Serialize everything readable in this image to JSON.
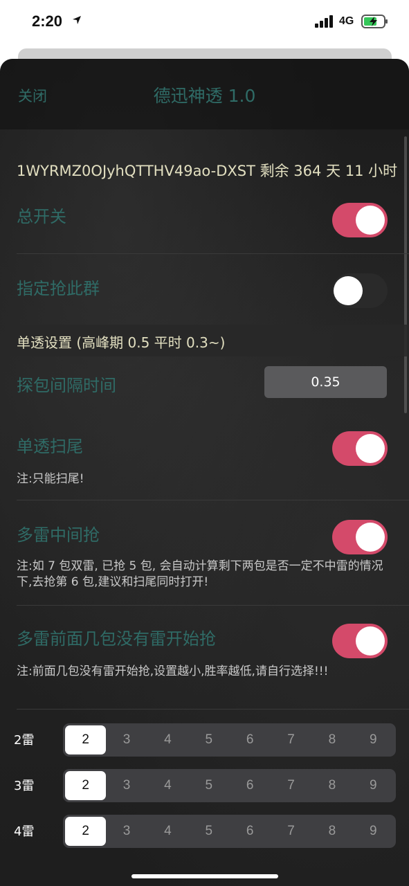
{
  "status": {
    "time": "2:20",
    "network": "4G"
  },
  "nav": {
    "close_label": "关闭",
    "title": "德迅神透 1.0"
  },
  "license_text": "1WYRMZ0OJyhQTTHV49ao-DXST 剩余 364 天 11 小时",
  "rows": {
    "master_switch": {
      "label": "总开关",
      "on": true
    },
    "target_group": {
      "label": "指定抢此群",
      "on": false
    }
  },
  "section": {
    "single_settings": "单透设置 (高峰期 0.5 平时 0.3~)"
  },
  "interval": {
    "label": "探包间隔时间",
    "value": "0.35"
  },
  "sweep_tail": {
    "label": "单透扫尾",
    "note": "注:只能扫尾!",
    "on": true
  },
  "multi_mid": {
    "label": "多雷中间抢",
    "note": "注:如 7 包双雷, 已抢 5 包, 会自动计算剩下两包是否一定不中雷的情况下,去抢第 6 包,建议和扫尾同时打开!",
    "on": true
  },
  "multi_front": {
    "label": "多雷前面几包没有雷开始抢",
    "note": "注:前面几包没有雷开始抢,设置越小,胜率越低,请自行选择!!!",
    "on": true
  },
  "segments": [
    {
      "label": "2雷",
      "options": [
        "2",
        "3",
        "4",
        "5",
        "6",
        "7",
        "8",
        "9"
      ],
      "selected": "2"
    },
    {
      "label": "3雷",
      "options": [
        "2",
        "3",
        "4",
        "5",
        "6",
        "7",
        "8",
        "9"
      ],
      "selected": "2"
    },
    {
      "label": "4雷",
      "options": [
        "2",
        "3",
        "4",
        "5",
        "6",
        "7",
        "8",
        "9"
      ],
      "selected": "2"
    }
  ],
  "colors": {
    "toggle_on": "#d44a6a",
    "label_teal": "#2f6b66",
    "header_cream": "#e2dfc0"
  }
}
